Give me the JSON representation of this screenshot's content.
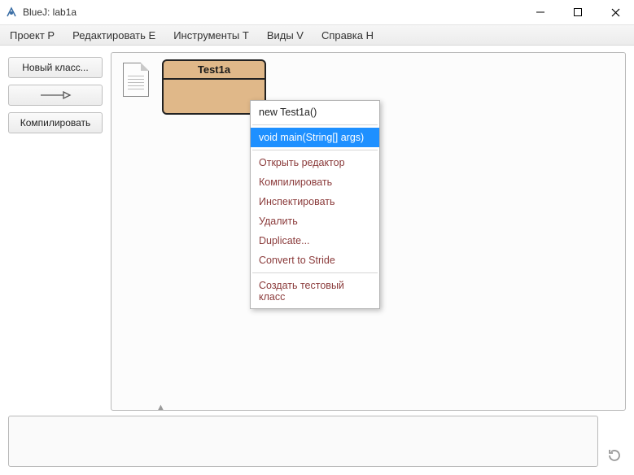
{
  "window": {
    "title": "BlueJ:  lab1a"
  },
  "menubar": {
    "items": [
      "Проект P",
      "Редактировать E",
      "Инструменты T",
      "Виды V",
      "Справка H"
    ]
  },
  "toolbar": {
    "new_class": "Новый класс...",
    "compile": "Компилировать"
  },
  "canvas": {
    "class_name": "Test1a"
  },
  "context_menu": {
    "new_instance": "new Test1a()",
    "main": "void main(String[] args)",
    "open_editor": "Открыть редактор",
    "compile": "Компилировать",
    "inspect": "Инспектировать",
    "remove": "Удалить",
    "duplicate": "Duplicate...",
    "convert": "Convert to Stride",
    "create_test": "Создать тестовый класс"
  }
}
